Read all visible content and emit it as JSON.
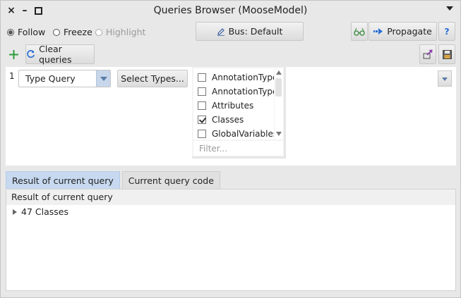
{
  "window": {
    "title": "Queries Browser (MooseModel)",
    "controls": {
      "close": "×",
      "minimize": "–"
    }
  },
  "toolbar": {
    "modes": [
      {
        "label": "Follow",
        "selected": true,
        "enabled": true
      },
      {
        "label": "Freeze",
        "selected": false,
        "enabled": true
      },
      {
        "label": "Highlight",
        "selected": false,
        "enabled": false
      }
    ],
    "bus_label": "Bus: Default",
    "propagate_label": "Propagate",
    "help_label": "?"
  },
  "actions": {
    "clear_label": "Clear queries"
  },
  "query": {
    "line_number": "1",
    "type_selected": "Type Query",
    "select_types_label": "Select Types...",
    "types": [
      {
        "label": "AnnotationType",
        "checked": false
      },
      {
        "label": "AnnotationType",
        "checked": false
      },
      {
        "label": "Attributes",
        "checked": false
      },
      {
        "label": "Classes",
        "checked": true
      },
      {
        "label": "GlobalVariables",
        "checked": false
      }
    ],
    "filter_placeholder": "Filter..."
  },
  "tabs": [
    {
      "label": "Result of current query",
      "active": true
    },
    {
      "label": "Current query code",
      "active": false
    }
  ],
  "result": {
    "header": "Result of current query",
    "rows": [
      {
        "label": "47 Classes"
      }
    ]
  },
  "colors": {
    "accent_tab": "#c7d9f0",
    "dropdown_arrow": "#5a7aa8",
    "add_icon": "#2e9b3e",
    "propagate_icon": "#2a6fd6"
  },
  "icons": {
    "add": "plus-icon",
    "refresh": "refresh-icon",
    "bus": "pencil-icon",
    "propagate": "propagate-arrow-icon",
    "glasses": "glasses-icon",
    "export": "export-icon",
    "save": "save-icon"
  }
}
